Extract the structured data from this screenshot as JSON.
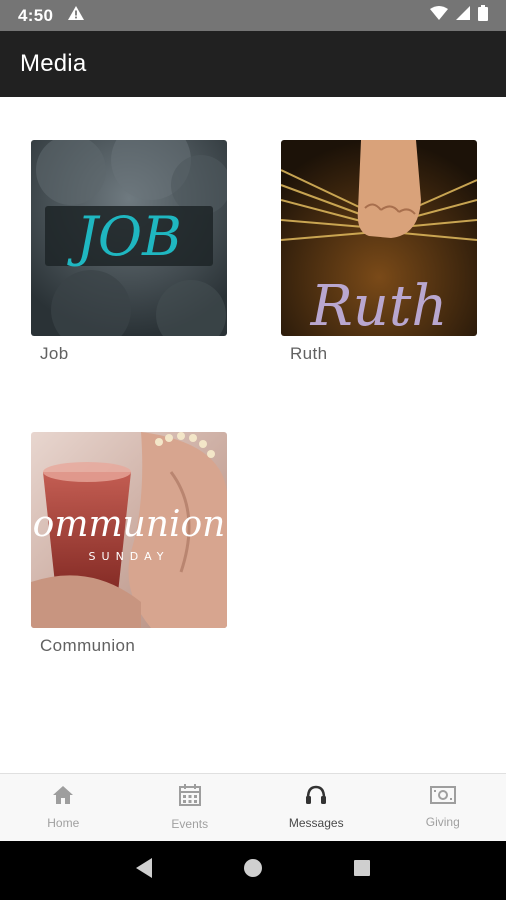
{
  "status_bar": {
    "time": "4:50",
    "icons": [
      "alert-icon",
      "wifi-icon",
      "signal-icon",
      "battery-icon"
    ]
  },
  "app_bar": {
    "title": "Media",
    "background": "#212121"
  },
  "media": [
    {
      "label": "Job",
      "thumb_text": "JOB",
      "thumb_text_color": "#1fb7c1"
    },
    {
      "label": "Ruth",
      "thumb_text": "Ruth",
      "thumb_text_color": "#b9a7d0"
    },
    {
      "label": "Communion",
      "thumb_text": "ommunion",
      "thumb_subtext": "SUNDAY",
      "thumb_text_color": "#ffffff"
    }
  ],
  "bottom_nav": {
    "items": [
      {
        "label": "Home",
        "icon": "home-icon",
        "active": false
      },
      {
        "label": "Events",
        "icon": "calendar-icon",
        "active": false
      },
      {
        "label": "Messages",
        "icon": "headphones-icon",
        "active": true
      },
      {
        "label": "Giving",
        "icon": "money-icon",
        "active": false
      }
    ]
  },
  "system_nav": {
    "icons": [
      "back-icon",
      "home-circle-icon",
      "recents-icon"
    ]
  }
}
